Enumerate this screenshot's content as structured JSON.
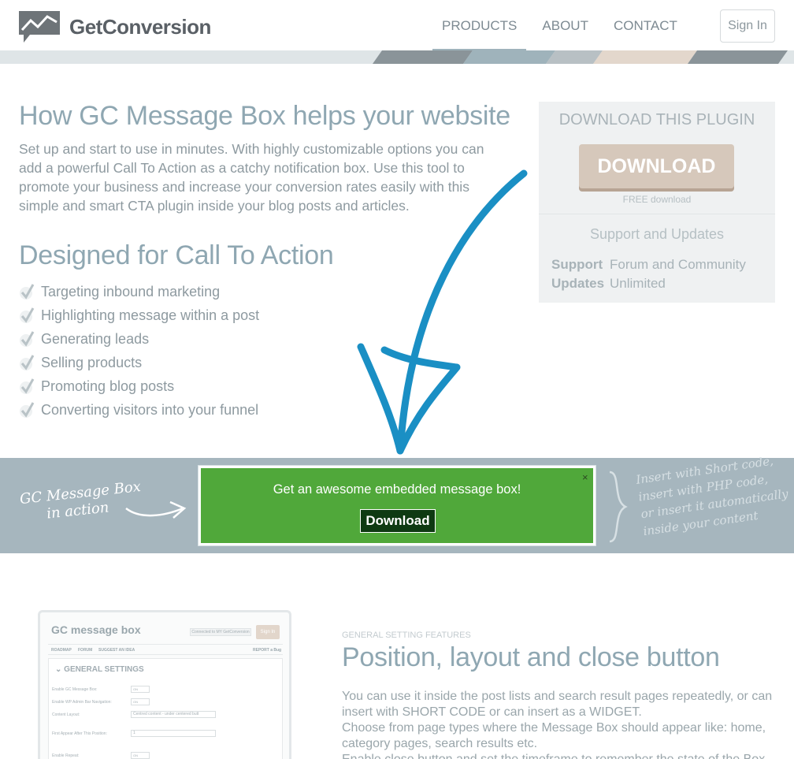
{
  "header": {
    "brand": "GetConversion",
    "nav": [
      {
        "label": "PRODUCTS",
        "active": true
      },
      {
        "label": "ABOUT",
        "active": false
      },
      {
        "label": "CONTACT",
        "active": false
      }
    ],
    "signin": "Sign In"
  },
  "main": {
    "title": "How GC Message Box helps your website",
    "intro": "Set up and start to use in minutes. With highly customizable options you can add a powerful Call To Action as a catchy notification box. Use this tool to promote your business and increase your conversion rates easily with this simple and smart CTA plugin inside your blog posts and articles.",
    "subtitle": "Designed for Call To Action",
    "features": [
      "Targeting inbound marketing",
      "Highlighting message within a post",
      "Generating leads",
      "Selling products",
      "Promoting blog posts",
      "Converting visitors into your funnel"
    ]
  },
  "sidebar": {
    "title": "DOWNLOAD THIS PLUGIN",
    "download_label": "DOWNLOAD",
    "free_note": "FREE download",
    "support_title": "Support and Updates",
    "support_key": "Support",
    "support_value": "Forum and Community",
    "updates_key": "Updates",
    "updates_value": "Unlimited"
  },
  "demo": {
    "left_line1": "GC Message Box",
    "left_line2": "in action",
    "message": "Get an awesome embedded message box!",
    "close": "×",
    "button": "Download",
    "right_lines": [
      "Insert with Short code,",
      "insert with PHP code,",
      "or insert it automatically",
      "inside your content"
    ]
  },
  "screenshot": {
    "title": "GC message box",
    "connected": "Connected to MY GetConversion",
    "sign": "Sign In",
    "roadmap": "ROADMAP",
    "forum": "FORUM",
    "suggest": "SUGGEST AN IDEA",
    "report": "REPORT a Bug",
    "panel_title": "GENERAL SETTINGS",
    "rows": [
      {
        "label": "Enable GC Message Box:",
        "value": "ON"
      },
      {
        "label": "Enable WP Admin Bar Navigation:",
        "value": "ON"
      },
      {
        "label": "Content Layout:",
        "value": "Centred content - under centered butt"
      },
      {
        "label": "First Appear After This Position:",
        "value": "1"
      },
      {
        "label": "Enable Repeat:",
        "value": "ON"
      }
    ]
  },
  "section": {
    "tag": "GENERAL SETTING FEATURES",
    "title": "Position, layout and close button",
    "paragraphs": [
      "You can use it inside the post lists and search result pages repeatedly, or can insert with SHORT CODE or can insert as a WIDGET.",
      "Choose from page types where the Message Box should appear like: home, category pages, search results etc.",
      "Enable close button and set the timeframe to remember the state of the Box."
    ]
  },
  "colors": {
    "accent_blue": "#1a8fc4",
    "message_green": "#50a83a",
    "download_beige": "#d6c8bb"
  }
}
